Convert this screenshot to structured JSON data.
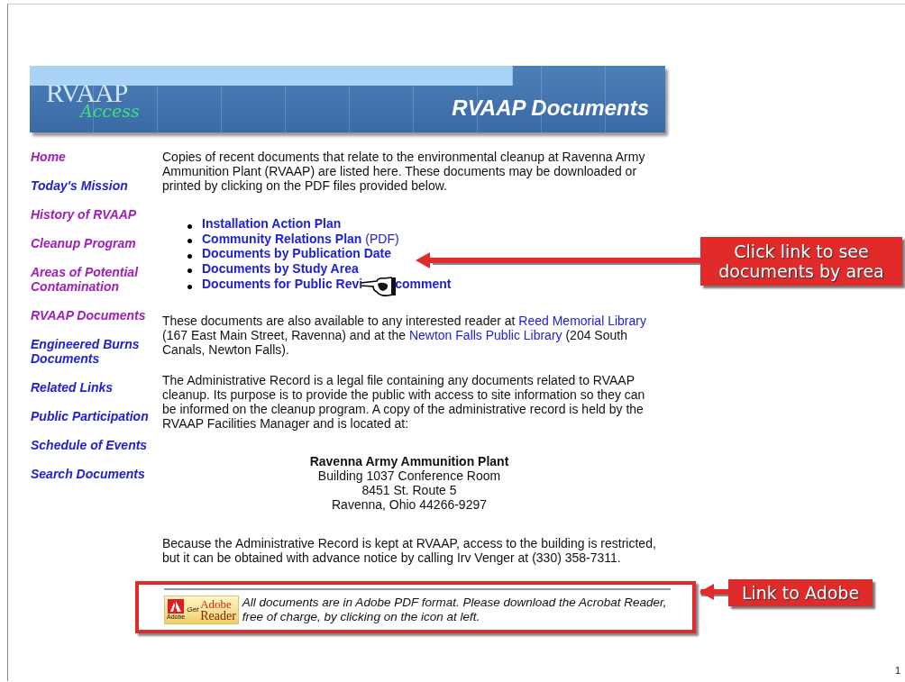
{
  "banner": {
    "logo_main": "RVAAP",
    "logo_script": "Access",
    "title": "RVAAP Documents"
  },
  "nav": [
    {
      "label": "Home",
      "visited": true
    },
    {
      "label": "Today's Mission",
      "visited": false
    },
    {
      "label": "History of RVAAP",
      "visited": true
    },
    {
      "label": "Cleanup Program",
      "visited": true
    },
    {
      "label": "Areas of Potential Contamination",
      "visited": true
    },
    {
      "label": "RVAAP Documents",
      "visited": true
    },
    {
      "label": "Engineered Burns Documents",
      "visited": false
    },
    {
      "label": "Related Links",
      "visited": false
    },
    {
      "label": "Public Participation",
      "visited": false
    },
    {
      "label": "Schedule of Events",
      "visited": false
    },
    {
      "label": "Search Documents",
      "visited": false
    }
  ],
  "intro": "Copies of recent documents that relate to the environmental cleanup at Ravenna Army Ammunition Plant (RVAAP) are listed here. These documents may be downloaded or printed by clicking on the PDF files provided below.",
  "documents": [
    {
      "label": "Installation Action Plan"
    },
    {
      "label": "Community Relations Plan",
      "note": "(PDF)"
    },
    {
      "label": "Documents by Publication Date"
    },
    {
      "label": "Documents by Study Area"
    },
    {
      "label": "Documents for Public Revi",
      "tail": "comment",
      "covered_by_hand": true
    }
  ],
  "availability": [
    {
      "kind": "text",
      "text": "These documents are also available to any interested reader at "
    },
    {
      "kind": "link",
      "text": "Reed Memorial Library"
    },
    {
      "kind": "text",
      "text": " (167 East Main Street, Ravenna) and at the "
    },
    {
      "kind": "link",
      "text": "Newton Falls Public Library"
    },
    {
      "kind": "text",
      "text": " (204 South Canals, Newton Falls)."
    }
  ],
  "admin_record": "The Administrative Record is a legal file containing any documents related to RVAAP cleanup. Its purpose is to provide the public with access to site information so they can be informed on the cleanup program. A copy of the administrative record is held by the RVAAP Facilities Manager and is located at:",
  "address": [
    "Ravenna Army Ammunition Plant",
    "Building 1037 Conference Room",
    "8451 St. Route 5",
    "Ravenna, Ohio 44266-9297"
  ],
  "access_note": "Because the Administrative Record is kept at RVAAP, access to the building is restricted, but it can be obtained with advance notice by calling Irv Venger at (330) 358-7311.",
  "footer": {
    "badge": {
      "get": "Get",
      "brand": "Adobe",
      "product": "Reader",
      "logo_caption": "Adobe"
    },
    "text": "All documents are in Adobe PDF format. Please download the Acrobat Reader, free of charge, by clicking on the icon at left."
  },
  "annotations": [
    {
      "kind": "links",
      "text": "Click link to see documents by area"
    },
    {
      "kind": "footer",
      "text": "Link to Adobe"
    }
  ],
  "slide_number": "1"
}
